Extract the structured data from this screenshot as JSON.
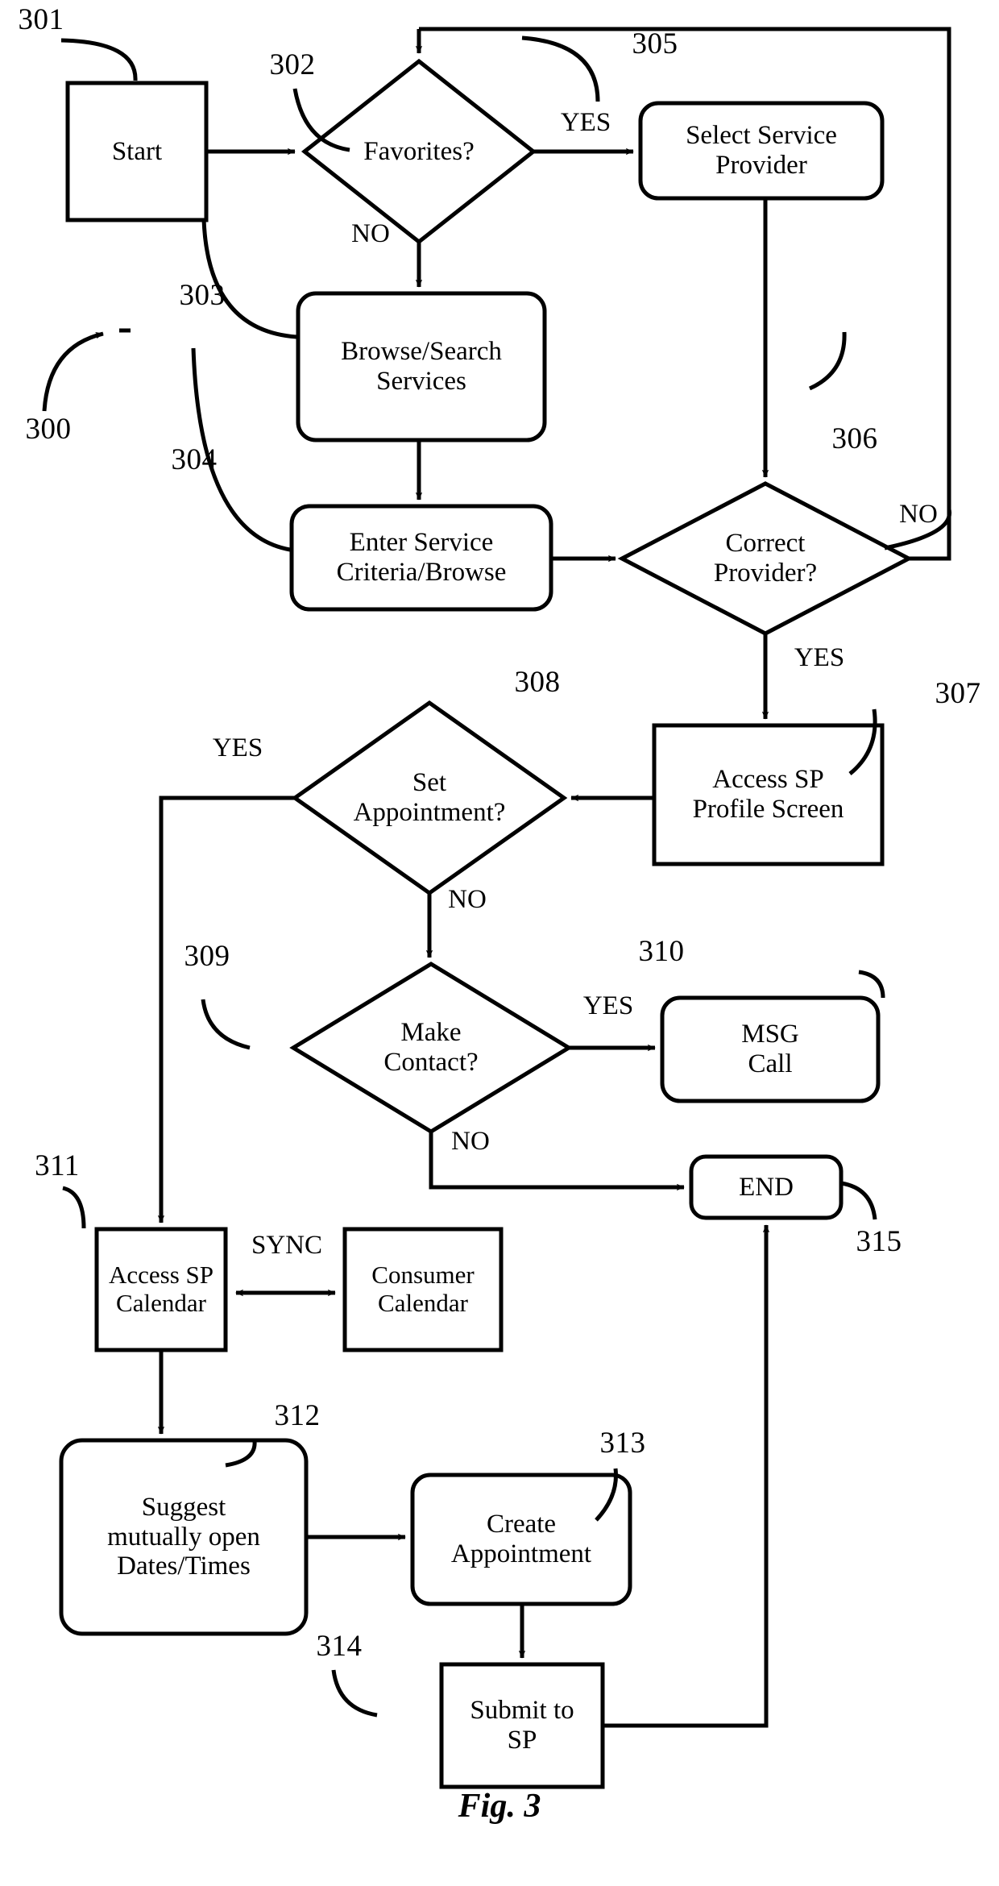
{
  "figure": {
    "caption": "Fig. 3",
    "overall_ref": "300"
  },
  "nodes": {
    "start": {
      "ref": "301",
      "label": "Start",
      "shape": "rect"
    },
    "favorites": {
      "ref": "302",
      "label": "Favorites?",
      "shape": "diamond"
    },
    "browse_search": {
      "ref": "303",
      "label": "Browse/Search\nServices",
      "shape": "rounded-rect"
    },
    "enter_criteria": {
      "ref": "304",
      "label": "Enter Service\nCriteria/Browse",
      "shape": "rounded-rect"
    },
    "select_provider": {
      "ref": "305",
      "label": "Select Service\nProvider",
      "shape": "rounded-rect"
    },
    "correct_provider": {
      "ref": "306",
      "label": "Correct\nProvider?",
      "shape": "diamond"
    },
    "access_profile": {
      "ref": "307",
      "label": "Access SP\nProfile Screen",
      "shape": "rect"
    },
    "set_appointment": {
      "ref": "308",
      "label": "Set\nAppointment?",
      "shape": "diamond"
    },
    "make_contact": {
      "ref": "309",
      "label": "Make\nContact?",
      "shape": "diamond"
    },
    "msg_call": {
      "ref": "310",
      "label": "MSG\nCall",
      "shape": "rounded-rect"
    },
    "access_sp_calendar": {
      "ref": "311",
      "label": "Access SP\nCalendar",
      "shape": "rect"
    },
    "consumer_calendar": {
      "ref": "",
      "label": "Consumer\nCalendar",
      "shape": "rect"
    },
    "suggest_times": {
      "ref": "312",
      "label": "Suggest\nmutually open\nDates/Times",
      "shape": "rounded-rect"
    },
    "create_appointment": {
      "ref": "313",
      "label": "Create\nAppointment",
      "shape": "rounded-rect"
    },
    "submit_to_sp": {
      "ref": "314",
      "label": "Submit to\nSP",
      "shape": "rect"
    },
    "end": {
      "ref": "315",
      "label": "END",
      "shape": "rounded-rect"
    }
  },
  "edge_labels": {
    "favorites_yes": "YES",
    "favorites_no": "NO",
    "correct_provider_no": "NO",
    "correct_provider_yes": "YES",
    "set_appointment_yes": "YES",
    "set_appointment_no": "NO",
    "make_contact_yes": "YES",
    "make_contact_no": "NO",
    "calendar_sync": "SYNC"
  },
  "colors": {
    "stroke": "#000000",
    "fill": "#ffffff",
    "text": "#000000"
  }
}
